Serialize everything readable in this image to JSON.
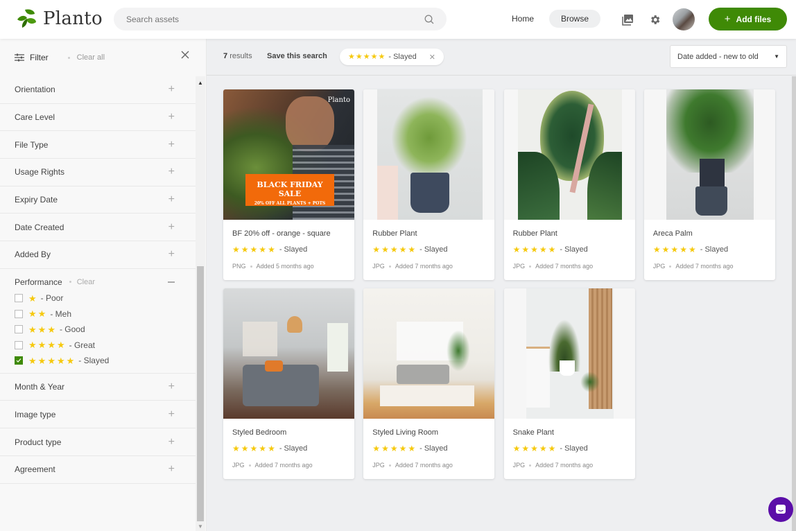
{
  "app": {
    "name": "Planto"
  },
  "header": {
    "search_placeholder": "Search assets",
    "nav": {
      "home": "Home",
      "browse": "Browse"
    },
    "add_files_label": "Add files",
    "accent_color": "#3f8a06"
  },
  "sidebar": {
    "filter_label": "Filter",
    "clear_all_label": "Clear all",
    "filters_before": [
      "Orientation",
      "Care Level",
      "File Type",
      "Usage Rights",
      "Expiry Date",
      "Date Created",
      "Added By"
    ],
    "performance": {
      "label": "Performance",
      "clear_label": "Clear",
      "options": [
        {
          "stars": 1,
          "label": "- Poor",
          "checked": false
        },
        {
          "stars": 2,
          "label": "- Meh",
          "checked": false
        },
        {
          "stars": 3,
          "label": "- Good",
          "checked": false
        },
        {
          "stars": 4,
          "label": "- Great",
          "checked": false
        },
        {
          "stars": 5,
          "label": "- Slayed",
          "checked": true
        }
      ]
    },
    "filters_after": [
      "Month & Year",
      "Image type",
      "Product type",
      "Agreement"
    ]
  },
  "results": {
    "count": "7",
    "count_suffix": "results",
    "save_search_label": "Save this search",
    "active_chip": {
      "stars": 5,
      "label": "- Slayed"
    },
    "sort_value": "Date added - new to old"
  },
  "assets": [
    {
      "title": "BF 20% off - orange - square",
      "stars": 5,
      "rating_label": "- Slayed",
      "type": "PNG",
      "added": "Added 5 months ago",
      "thumb": "blackfriday",
      "overlay_title": "BLACK FRIDAY SALE",
      "overlay_sub": "20% OFF ALL PLANTS + POTS",
      "overlay_brand": "Planto"
    },
    {
      "title": "Rubber Plant",
      "stars": 5,
      "rating_label": "- Slayed",
      "type": "JPG",
      "added": "Added 7 months ago",
      "thumb": "rubber1"
    },
    {
      "title": "Rubber Plant",
      "stars": 5,
      "rating_label": "- Slayed",
      "type": "JPG",
      "added": "Added 7 months ago",
      "thumb": "rubber2"
    },
    {
      "title": "Areca Palm",
      "stars": 5,
      "rating_label": "- Slayed",
      "type": "JPG",
      "added": "Added 7 months ago",
      "thumb": "palm"
    },
    {
      "title": "Styled Bedroom",
      "stars": 5,
      "rating_label": "- Slayed",
      "type": "JPG",
      "added": "Added 7 months ago",
      "thumb": "bedroom"
    },
    {
      "title": "Styled Living Room",
      "stars": 5,
      "rating_label": "- Slayed",
      "type": "JPG",
      "added": "Added 7 months ago",
      "thumb": "living"
    },
    {
      "title": "Snake Plant",
      "stars": 5,
      "rating_label": "- Slayed",
      "type": "JPG",
      "added": "Added 7 months ago",
      "thumb": "snake"
    }
  ]
}
